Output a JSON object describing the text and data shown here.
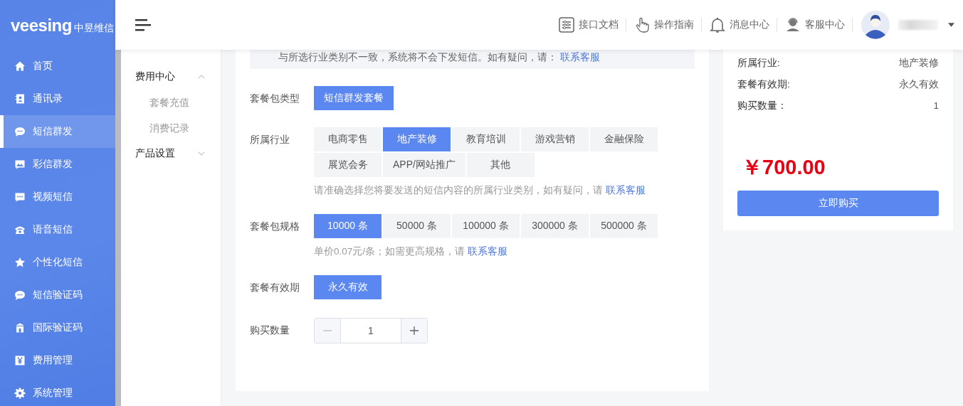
{
  "logo": {
    "brand": "veesing",
    "name": "中昱维信"
  },
  "header": {
    "links": [
      {
        "label": "接口文档"
      },
      {
        "label": "操作指南"
      },
      {
        "label": "消息中心"
      },
      {
        "label": "客服中心"
      }
    ]
  },
  "sidebar": {
    "items": [
      {
        "label": "首页",
        "selected": false
      },
      {
        "label": "通讯录",
        "selected": false
      },
      {
        "label": "短信群发",
        "selected": true
      },
      {
        "label": "彩信群发",
        "selected": false
      },
      {
        "label": "视频短信",
        "selected": false
      },
      {
        "label": "语音短信",
        "selected": false
      },
      {
        "label": "个性化短信",
        "selected": false
      },
      {
        "label": "短信验证码",
        "selected": false
      },
      {
        "label": "国际验证码",
        "selected": false
      },
      {
        "label": "费用管理",
        "selected": false
      },
      {
        "label": "系统管理",
        "selected": false
      }
    ]
  },
  "subnav": {
    "groups": [
      {
        "label": "费用中心",
        "expanded": true,
        "children": [
          {
            "label": "套餐充值"
          },
          {
            "label": "消费记录"
          }
        ]
      },
      {
        "label": "产品设置",
        "expanded": false
      }
    ]
  },
  "notice": {
    "text": "与所选行业类别不一致，系统将不会下发短信。如有疑问，请：",
    "link": "联系客服"
  },
  "form": {
    "fields": [
      {
        "kind": "options",
        "label": "套餐包类型",
        "options": [
          {
            "label": "短信群发套餐",
            "selected": true
          }
        ]
      },
      {
        "kind": "options",
        "label": "所属行业",
        "options": [
          {
            "label": "电商零售",
            "selected": false
          },
          {
            "label": "地产装修",
            "selected": true
          },
          {
            "label": "教育培训",
            "selected": false
          },
          {
            "label": "游戏营销",
            "selected": false
          },
          {
            "label": "金融保险",
            "selected": false
          },
          {
            "label": "展览会务",
            "selected": false
          },
          {
            "label": "APP/网站推广",
            "selected": false
          },
          {
            "label": "其他",
            "selected": false
          }
        ],
        "hint": "请准确选择您将要发送的短信内容的所属行业类别，如有疑问，请",
        "hint_link": "联系客服"
      },
      {
        "kind": "options",
        "label": "套餐包规格",
        "options": [
          {
            "label": "10000 条",
            "selected": true
          },
          {
            "label": "50000 条",
            "selected": false
          },
          {
            "label": "100000 条",
            "selected": false
          },
          {
            "label": "300000 条",
            "selected": false
          },
          {
            "label": "500000 条",
            "selected": false
          }
        ],
        "hint": "单价0.07元/条；如需更高规格，请",
        "hint_link": "联系客服"
      },
      {
        "kind": "options",
        "label": "套餐有效期",
        "options": [
          {
            "label": "永久有效",
            "selected": true
          }
        ]
      },
      {
        "kind": "stepper",
        "label": "购买数量",
        "value": "1",
        "minus_disabled": true
      }
    ]
  },
  "summary": {
    "rows": [
      {
        "label": "所属行业:",
        "value": "地产装修"
      },
      {
        "label": "套餐有效期:",
        "value": "永久有效"
      },
      {
        "label": "购买数量：",
        "value": "1"
      }
    ],
    "price": "￥700.00",
    "buy_button": "立即购买"
  }
}
